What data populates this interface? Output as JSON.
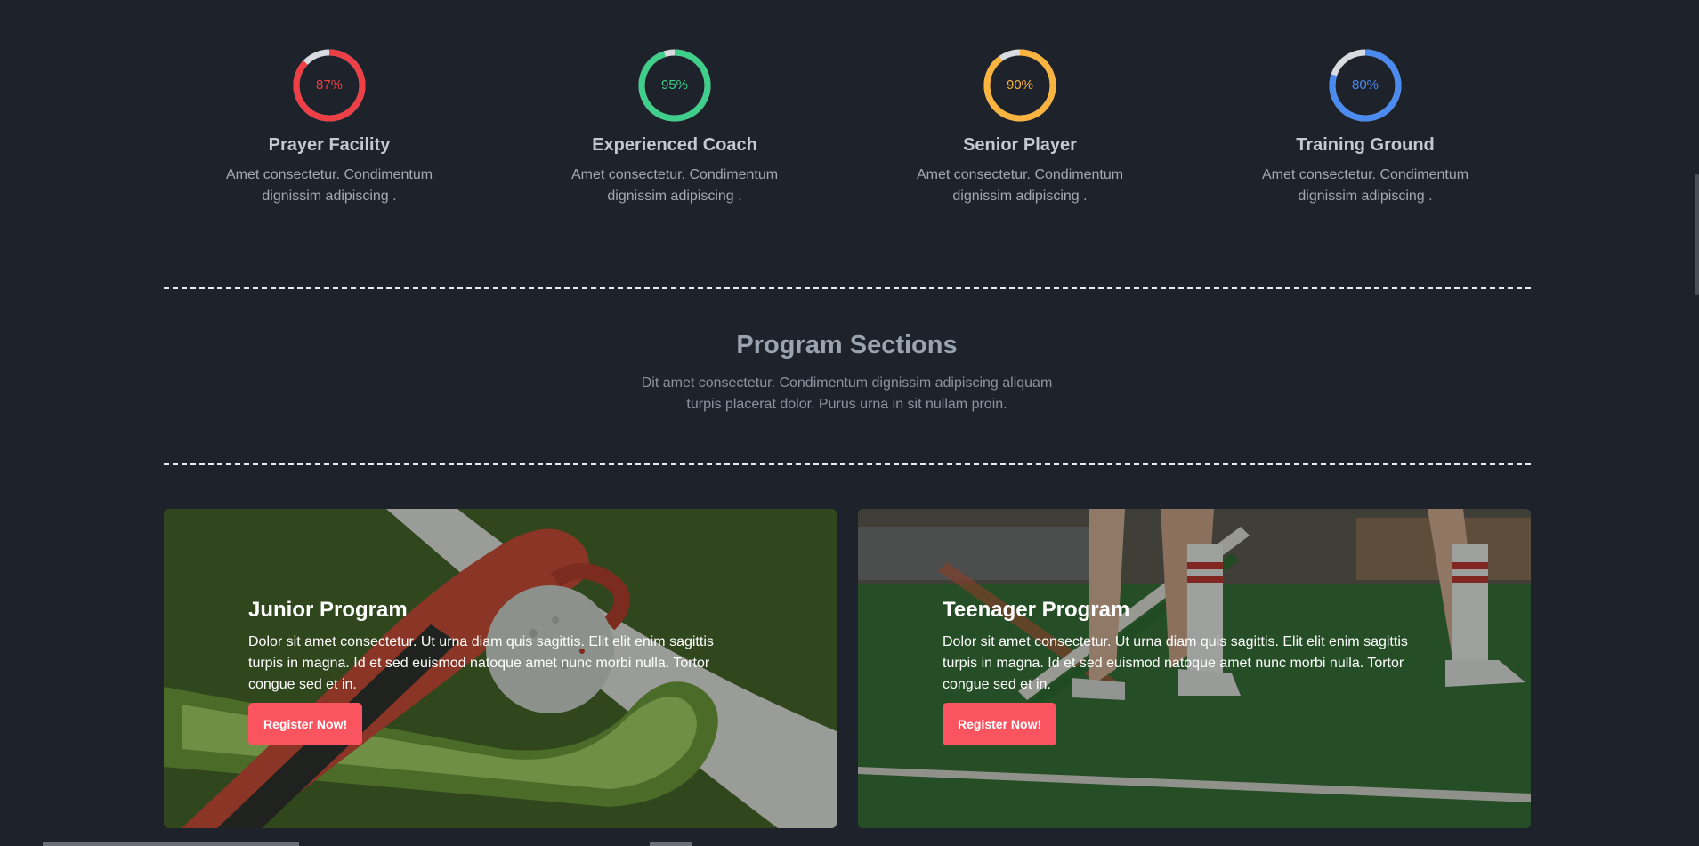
{
  "stats": [
    {
      "value": "87%",
      "percent": 87,
      "color": "#ee3e46",
      "title": "Prayer Facility",
      "desc": "Amet consectetur. Condimentum dignissim adipiscing ."
    },
    {
      "value": "95%",
      "percent": 95,
      "color": "#3fcf8a",
      "title": "Experienced Coach",
      "desc": "Amet consectetur. Condimentum dignissim adipiscing ."
    },
    {
      "value": "90%",
      "percent": 90,
      "color": "#f9b33f",
      "title": "Senior Player",
      "desc": "Amet consectetur. Condimentum dignissim adipiscing ."
    },
    {
      "value": "80%",
      "percent": 80,
      "color": "#4b8bf0",
      "title": "Training Ground",
      "desc": "Amet consectetur. Condimentum dignissim adipiscing ."
    }
  ],
  "programs": {
    "title": "Program Sections",
    "desc": "Dit amet consectetur. Condimentum dignissim adipiscing aliquam turpis placerat dolor. Purus urna in sit nullam proin."
  },
  "cards": [
    {
      "title": "Junior Program",
      "desc": "Dolor sit amet consectetur. Ut urna diam quis sagittis. Elit elit enim sagittis turpis in magna. Id et sed euismod natoque amet nunc morbi nulla. Tortor congue sed et in.",
      "button": "Register Now!"
    },
    {
      "title": "Teenager Program",
      "desc": "Dolor sit amet consectetur. Ut urna diam quis sagittis. Elit elit enim sagittis turpis in magna. Id et sed euismod natoque amet nunc morbi nulla. Tortor congue sed et in.",
      "button": "Register Now!"
    }
  ]
}
